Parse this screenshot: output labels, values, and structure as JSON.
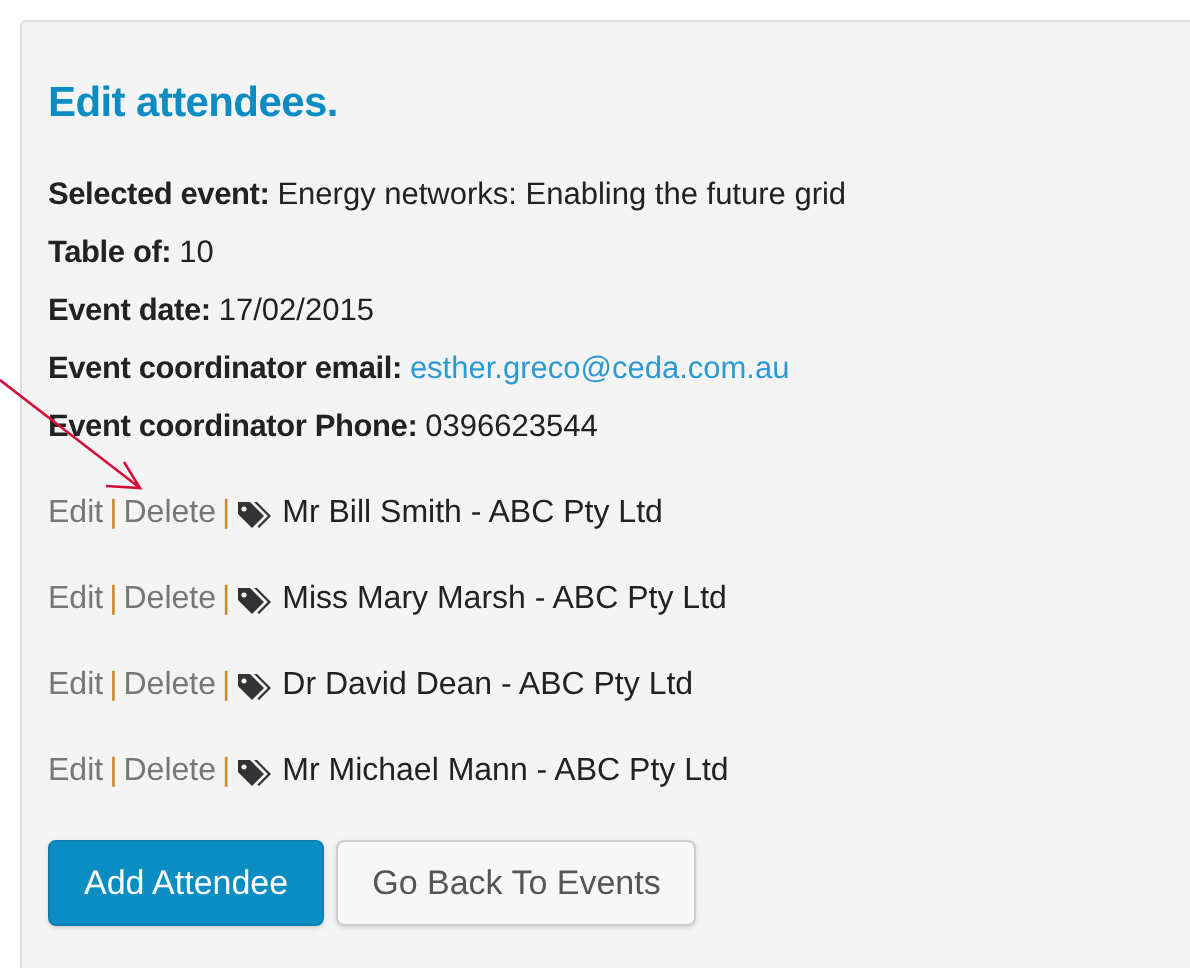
{
  "panel": {
    "title": "Edit attendees.",
    "details": [
      {
        "label": "Selected event:",
        "value": "Energy networks: Enabling the future grid",
        "kind": "text"
      },
      {
        "label": "Table of:",
        "value": "10",
        "kind": "text"
      },
      {
        "label": "Event date:",
        "value": "17/02/2015",
        "kind": "text"
      },
      {
        "label": "Event coordinator email:",
        "value": "esther.greco@ceda.com.au",
        "kind": "link"
      },
      {
        "label": "Event coordinator Phone:",
        "value": "0396623544",
        "kind": "text"
      }
    ],
    "attendees": [
      {
        "edit": "Edit",
        "separator_1": "|",
        "delete": "Delete",
        "separator_2": "|",
        "name": "Mr Bill Smith - ABC Pty Ltd"
      },
      {
        "edit": "Edit",
        "separator_1": "|",
        "delete": "Delete",
        "separator_2": "|",
        "name": "Miss Mary Marsh - ABC Pty Ltd"
      },
      {
        "edit": "Edit",
        "separator_1": "|",
        "delete": "Delete",
        "separator_2": "|",
        "name": "Dr David Dean - ABC Pty Ltd"
      },
      {
        "edit": "Edit",
        "separator_1": "|",
        "delete": "Delete",
        "separator_2": "|",
        "name": "Mr Michael Mann - ABC Pty Ltd"
      }
    ],
    "buttons": [
      {
        "label": "Add Attendee",
        "kind": "primary"
      },
      {
        "label": "Go Back To Events",
        "kind": "default"
      }
    ]
  }
}
